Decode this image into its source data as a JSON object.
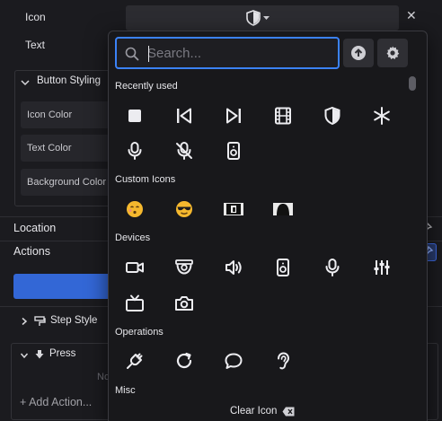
{
  "panel": {
    "icon_label": "Icon",
    "text_label": "Text",
    "button_styling_title": "Button Styling",
    "icon_color_label": "Icon Color",
    "text_color_label": "Text Color",
    "background_color_label": "Background Color",
    "location_label": "Location",
    "actions_label": "Actions",
    "step_style_label": "Step Style",
    "press_label": "Press",
    "no_actions_text": "No",
    "add_action_label": "+ Add Action..."
  },
  "picker": {
    "search_placeholder": "Search...",
    "search_value": "",
    "clear_icon_label": "Clear Icon",
    "categories": {
      "recently_used": "Recently used",
      "custom_icons": "Custom Icons",
      "devices": "Devices",
      "operations": "Operations",
      "misc": "Misc"
    },
    "recently_used_icons": [
      "stop-icon",
      "skip-back-icon",
      "skip-forward-icon",
      "film-icon",
      "shield-half-icon",
      "asterisk-icon",
      "microphone-icon",
      "microphone-off-icon",
      "speaker-icon"
    ],
    "custom_icons": [
      "emoji-kissing",
      "emoji-sunglasses",
      "custom-image-1",
      "custom-image-2"
    ],
    "device_icons": [
      "video-camera-icon",
      "security-camera-icon",
      "volume-icon",
      "speaker-icon",
      "microphone-icon",
      "equalizer-icon",
      "tv-icon",
      "camera-icon"
    ],
    "operation_icons": [
      "plug-icon",
      "refresh-icon",
      "chat-icon",
      "ear-icon"
    ]
  },
  "colors": {
    "accent": "#3b82f6",
    "button_blue": "#3367d6",
    "popover_bg": "#18181b",
    "panel_bg": "#1b1b1f"
  }
}
